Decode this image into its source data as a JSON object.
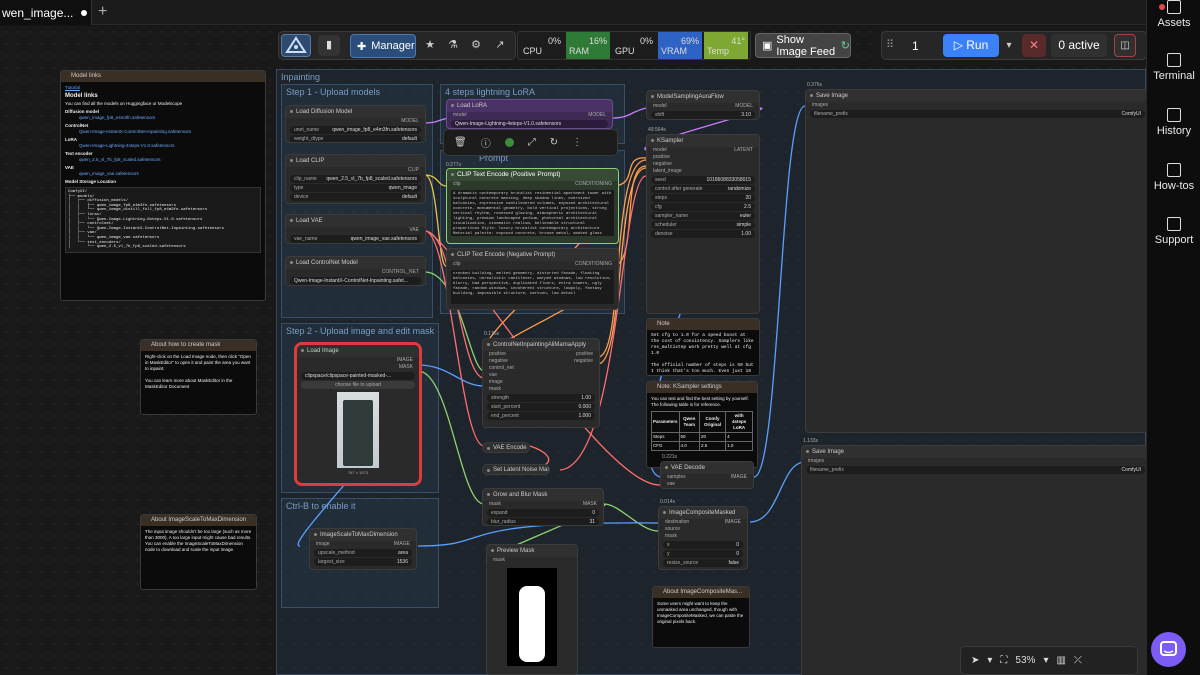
{
  "tab": {
    "title": "wen_image...",
    "new_tab": "+"
  },
  "sidebar": {
    "items": [
      {
        "label": "Assets",
        "icon": "assets-icon"
      },
      {
        "label": "Terminal",
        "icon": "terminal-icon"
      },
      {
        "label": "History",
        "icon": "history-icon"
      },
      {
        "label": "How-tos",
        "icon": "howtos-icon"
      },
      {
        "label": "Support",
        "icon": "support-icon"
      }
    ]
  },
  "toolbar": {
    "manager_label": "Manager",
    "meters": [
      {
        "label": "CPU",
        "value": "0%",
        "color": "#1d1d1d"
      },
      {
        "label": "RAM",
        "value": "16%",
        "color": "#2f7a36"
      },
      {
        "label": "GPU",
        "value": "0%",
        "color": "#1d1d1d"
      },
      {
        "label": "VRAM",
        "value": "69%",
        "color": "#2e62c4"
      },
      {
        "label": "Temp",
        "value": "41°",
        "color": "#7fa832"
      }
    ],
    "image_feed_label": "Show Image Feed",
    "batch_count": "1",
    "run_label": "Run",
    "active_label": "0 active"
  },
  "groups": {
    "inpainting": "Inpainting",
    "step1": "Step 1 - Upload models",
    "lora": "4 steps lightning LoRA",
    "step2": "Step 2 - Upload image and edit mask",
    "prompt": "Prompt",
    "ctrlb": "Ctrl-B to enable it"
  },
  "nodes": {
    "model_links": {
      "title": "Model links",
      "tutorial": "Tutorial",
      "heading": "Model links",
      "intro": "You can find all the models on Huggingface or Modelscope",
      "diffusion": "Diffusion model",
      "diff_file": "qwen_image_fp8_e4m3fn.safetensors",
      "controlnet": "ControlNet",
      "cn_file": "Qwen-Image-InstantX-ControlNet-Inpainting.safetensors",
      "lora": "LoRA",
      "lora_file": "Qwen-Image-Lightning-4steps-V1.0.safetensors",
      "te": "Text encoder",
      "te_file": "qwen_2.5_vl_7b_fp8_scaled.safetensors",
      "vae": "VAE",
      "vae_file": "qwen_image_vae.safetensors",
      "storage": "Model Storage Location",
      "tree": "ComfyUI/\n├── models/\n│   ├── diffusion_models/\n│   │   ├── qwen_image_fp8_e4m3fn.safetensors\n│   │   └── qwen_image_distill_full_fp8_e4m3fn.safetensors\n│   ├── loras/\n│   │   └── Qwen-Image-Lightning-8steps-V1.0.safetensors\n│   ├── controlnet/\n│   │   └── Qwen-Image-InstantX-ControlNet-Inpainting.safetensors\n│   ├── vae/\n│   │   └── qwen_image_vae.safetensors\n│   └── text_encoders/\n│       └── qwen_2.5_vl_7b_fp8_scaled.safetensors"
    },
    "load_diffusion": {
      "title": "Load Diffusion Model",
      "out": "MODEL",
      "unet_label": "unet_name",
      "unet_value": "qwen_image_fp8_e4m3fn.safetensors",
      "dtype_label": "weight_dtype",
      "dtype_value": "default"
    },
    "load_clip": {
      "title": "Load CLIP",
      "out": "CLIP",
      "name_label": "clip_name",
      "name_value": "qwen_2.5_vl_7b_fp8_scaled.safetensors",
      "type_label": "type",
      "type_value": "qwen_image",
      "device_label": "device",
      "device_value": "default"
    },
    "load_vae": {
      "title": "Load VAE",
      "out": "VAE",
      "name_label": "vae_name",
      "name_value": "qwen_image_vae.safetensors"
    },
    "load_controlnet": {
      "title": "Load ControlNet Model",
      "out": "CONTROL_NET",
      "value": "Qwen-Image-InstantX-ControlNet-Inpainting.safet..."
    },
    "load_lora": {
      "title": "Load LoRA",
      "in": "model",
      "out": "MODEL",
      "value": "Qwen-Image-Lightning-4steps-V1.0.safetensors"
    },
    "pos_prompt": {
      "title": "CLIP Text Encode (Positive Prompt)",
      "badge": "0.277s",
      "in": "clip",
      "out": "CONDITIONING",
      "text": "A dramatic contemporary brutalist residential apartment tower with sculptural concrete massing, deep shadow lines, oversized balconies, expressive cantilevered volumes, exposed architectural concrete, monumental geometry, bold vertical projections, strong vertical rhythm, recessed glazing, atmospheric architectural lighting, premium landscaped podium, photoreal architectural visualization, cinematic realism, believable structural proportions\n\nStyle: luxury brutalist contemporary architecture\nMaterial palette: exposed concrete, bronze metal, smoked glass"
    },
    "neg_prompt": {
      "title": "CLIP Text Encode (Negative Prompt)",
      "in": "clip",
      "out": "CONDITIONING",
      "text": "crooked building, melted geometry, distorted facade, floating balconies, unrealistic cantilever, warped windows, low resolution, blurry, bad perspective, duplicated floors, extra towers, ugly facade, random windows, incoherent structure, lowpoly, fantasy building, impossible structure, cartoon, low detail"
    },
    "model_sampling": {
      "title": "ModelSamplingAuraFlow",
      "in": "model",
      "out": "MODEL",
      "shift_label": "shift",
      "shift_value": "3.10"
    },
    "ksampler": {
      "title": "KSampler",
      "badge": "49.564s",
      "out": "LATENT",
      "inputs": [
        "model",
        "positive",
        "negative",
        "latent_image"
      ],
      "seed_label": "seed",
      "seed_value": "1018608833058015",
      "cag_label": "control after generate",
      "cag_value": "randomize",
      "steps_label": "steps",
      "steps_value": "20",
      "cfg_label": "cfg",
      "cfg_value": "2.5",
      "sampler_label": "sampler_name",
      "sampler_value": "euler",
      "scheduler_label": "scheduler",
      "scheduler_value": "simple",
      "denoise_label": "denoise",
      "denoise_value": "1.00"
    },
    "note1": {
      "title": "Note",
      "text": "Set cfg to 1.0 for a speed boost at the cost of consistency. Samplers like res_multistep work pretty well at cfg 1.0\n\nThe official number of steps is 50 but I think that's too much. Even just 10 steps seems to work."
    },
    "note2": {
      "title": "Note: KSampler settings",
      "text": "You can test and find the best setting by yourself. The following table is for reference.",
      "headers": [
        "Parameters",
        "Qwen Team",
        "Comfy Original",
        "with 4steps LoRA"
      ],
      "rows": [
        [
          "Steps",
          "50",
          "20",
          "4"
        ],
        [
          "CFG",
          "4.0",
          "2.5",
          "1.0"
        ]
      ]
    },
    "controlnet_apply": {
      "title": "ControlNetInpaintingAliMamaApply",
      "badge": "0.176s",
      "inputs": [
        "positive",
        "negative",
        "control_net",
        "vae",
        "image",
        "mask"
      ],
      "outputs": [
        "positive",
        "negative"
      ],
      "strength_label": "strength",
      "strength_value": "1.00",
      "start_label": "start_percent",
      "start_value": "0.000",
      "end_label": "end_percent",
      "end_value": "1.000"
    },
    "load_image": {
      "title": "Load Image",
      "out1": "IMAGE",
      "out2": "MASK",
      "file": "clipspace/clipspace-painted-masked-...",
      "upload": "choose file to upload",
      "size": "767 × 1573"
    },
    "about_mask": {
      "title": "About how to create mask",
      "text": "Right-click on the Load Image node, then click \"Open in MaskEditor\" to open it and paint the area you want to inpaint.\n\nYou can learn more about MaskEditor in the MaskEditor Document"
    },
    "about_scale": {
      "title": "About ImageScaleToMaxDimension",
      "text": "The input image shouldn't be too large (such as more than 3000), A too large input might cause bad results. You can enable the ImageScaleToMaxDimension node to download and scale the input image."
    },
    "scale_node": {
      "title": "ImageScaleToMaxDimension",
      "in": "image",
      "out": "IMAGE",
      "method_label": "upscale_method",
      "method_value": "area",
      "size_label": "largest_size",
      "size_value": "1536"
    },
    "vae_encode": {
      "title": "VAE Encode"
    },
    "latent_mask": {
      "title": "Set Latent Noise Mask"
    },
    "grow_blur": {
      "title": "Grow and Blur Mask",
      "in": "mask",
      "out": "MASK",
      "expand_label": "expand",
      "expand_value": "0",
      "blur_label": "blur_radius",
      "blur_value": "31"
    },
    "preview_mask": {
      "title": "Preview Mask",
      "in": "mask"
    },
    "vae_decode": {
      "title": "VAE Decode",
      "badge": "0.221s",
      "in1": "samples",
      "in2": "vae",
      "out": "IMAGE"
    },
    "composite": {
      "title": "ImageCompositeMasked",
      "badge": "0.014s",
      "inputs": [
        "destination",
        "source",
        "mask"
      ],
      "out": "IMAGE",
      "x_label": "x",
      "x_value": "0",
      "y_label": "y",
      "y_value": "0",
      "resize_label": "resize_source",
      "resize_value": "false"
    },
    "about_composite": {
      "title": "About ImageCompositeMas...",
      "text": "Some users might want to keep the unmasked area unchanged, though with ImageCompositeMasked, we can paste the original pixels back."
    },
    "save1": {
      "title": "Save Image",
      "badge": "0.376s",
      "in": "images",
      "prefix_label": "filename_prefix",
      "prefix_value": "ComfyUI"
    },
    "save2": {
      "title": "Save Image",
      "badge": "1.133s",
      "in": "images",
      "prefix_label": "filename_prefix",
      "prefix_value": "ComfyUI"
    }
  },
  "canvas_toolbar": {
    "zoom": "53%"
  },
  "colors": {
    "accent": "#3b82f6",
    "selected_border": "#e03a3a",
    "wire_yellow": "#e8c547",
    "wire_purple": "#c77dff",
    "wire_green": "#8ed26f",
    "wire_blue": "#5aa0ff",
    "wire_red": "#ff6f6f"
  }
}
